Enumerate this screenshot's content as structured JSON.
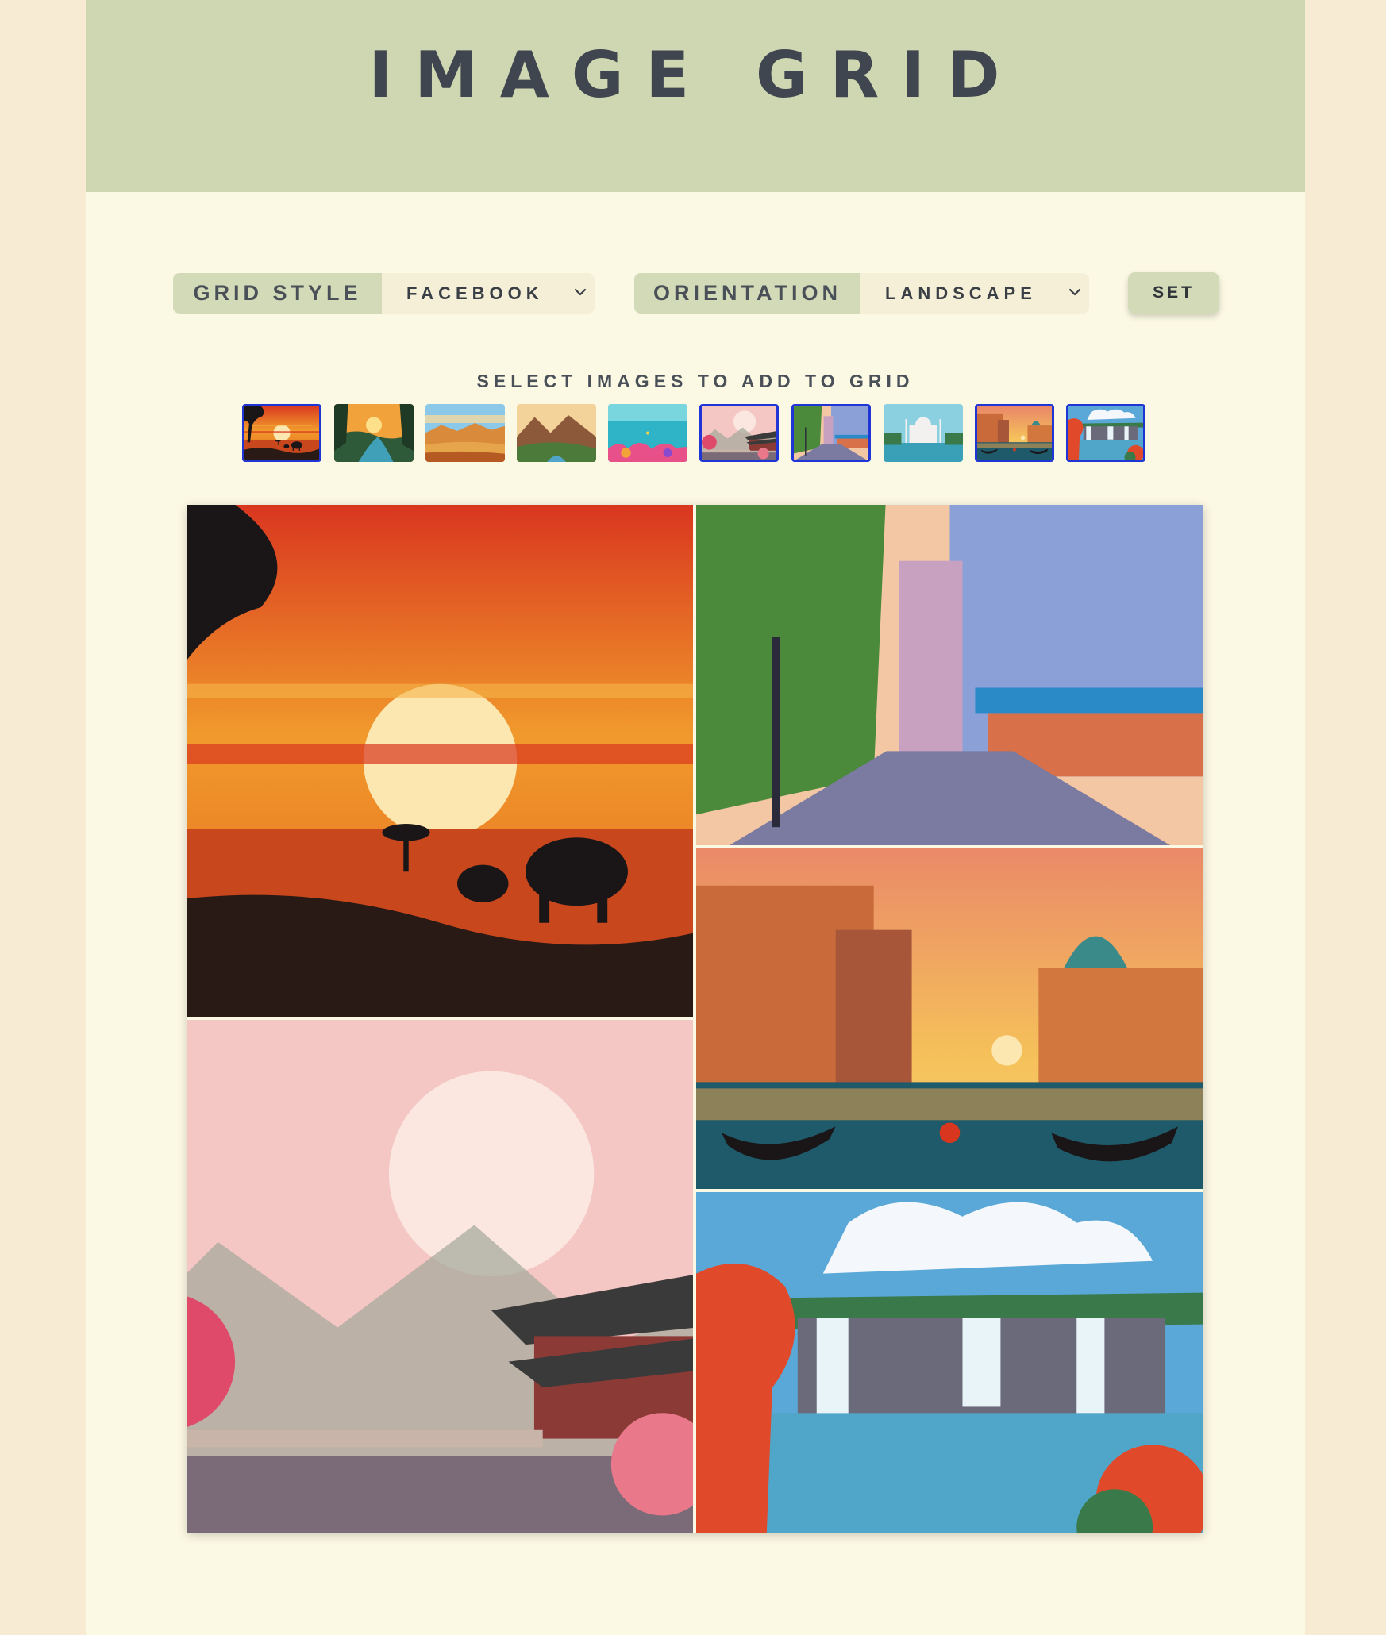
{
  "header": {
    "title": "IMAGE GRID"
  },
  "controls": {
    "grid_style": {
      "label": "GRID STYLE",
      "value": "FACEBOOK"
    },
    "orientation": {
      "label": "ORIENTATION",
      "value": "LANDSCAPE"
    },
    "set_label": "SET"
  },
  "picker": {
    "heading": "SELECT IMAGES TO ADD TO GRID",
    "thumbnails": [
      {
        "scene": "savanna-sunset",
        "selected": true
      },
      {
        "scene": "jungle-river",
        "selected": false
      },
      {
        "scene": "desert-canyon",
        "selected": false
      },
      {
        "scene": "mountain-valley",
        "selected": false
      },
      {
        "scene": "coral-reef",
        "selected": false
      },
      {
        "scene": "japanese-temple",
        "selected": true
      },
      {
        "scene": "paris-street",
        "selected": true
      },
      {
        "scene": "taj-mahal",
        "selected": false
      },
      {
        "scene": "venice-canal",
        "selected": true
      },
      {
        "scene": "waterfall",
        "selected": true
      }
    ]
  },
  "grid": {
    "tiles": [
      "savanna-sunset",
      "paris-street",
      "venice-canal",
      "japanese-temple",
      "waterfall"
    ]
  },
  "colors": {
    "page_background": "#f7ecd3",
    "panel_background": "#fbf8e3",
    "header_background": "#cfd7b2",
    "selected_border": "#1f35d6"
  }
}
